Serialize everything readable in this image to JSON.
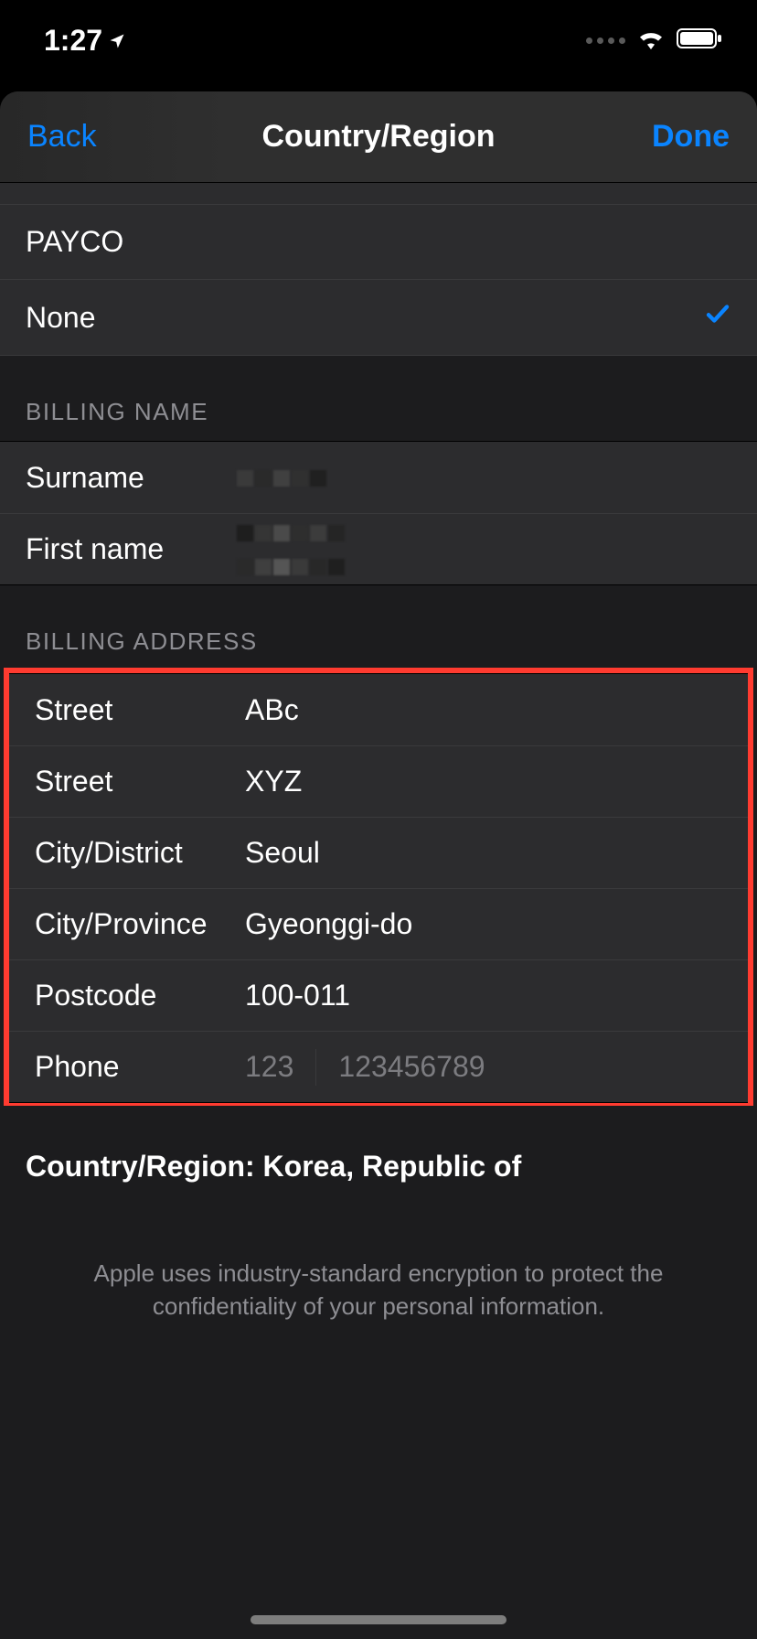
{
  "status": {
    "time": "1:27"
  },
  "nav": {
    "back": "Back",
    "title": "Country/Region",
    "done": "Done"
  },
  "payment_options": {
    "option1": "PAYCO",
    "option2": "None"
  },
  "sections": {
    "billing_name_header": "BILLING NAME",
    "billing_address_header": "BILLING ADDRESS"
  },
  "billing_name": {
    "surname_label": "Surname",
    "surname_value": "",
    "firstname_label": "First name",
    "firstname_value": ""
  },
  "billing_address": {
    "street1_label": "Street",
    "street1_value": "ABc",
    "street2_label": "Street",
    "street2_value": "XYZ",
    "city_district_label": "City/District",
    "city_district_value": "Seoul",
    "city_province_label": "City/Province",
    "city_province_value": "Gyeonggi-do",
    "postcode_label": "Postcode",
    "postcode_value": "100-011",
    "phone_label": "Phone",
    "phone_cc_placeholder": "123",
    "phone_num_placeholder": "123456789"
  },
  "country_region": {
    "label": "Country/Region: ",
    "value": "Korea, Republic of"
  },
  "footer": "Apple uses industry-standard encryption to protect the confidentiality of your personal information."
}
